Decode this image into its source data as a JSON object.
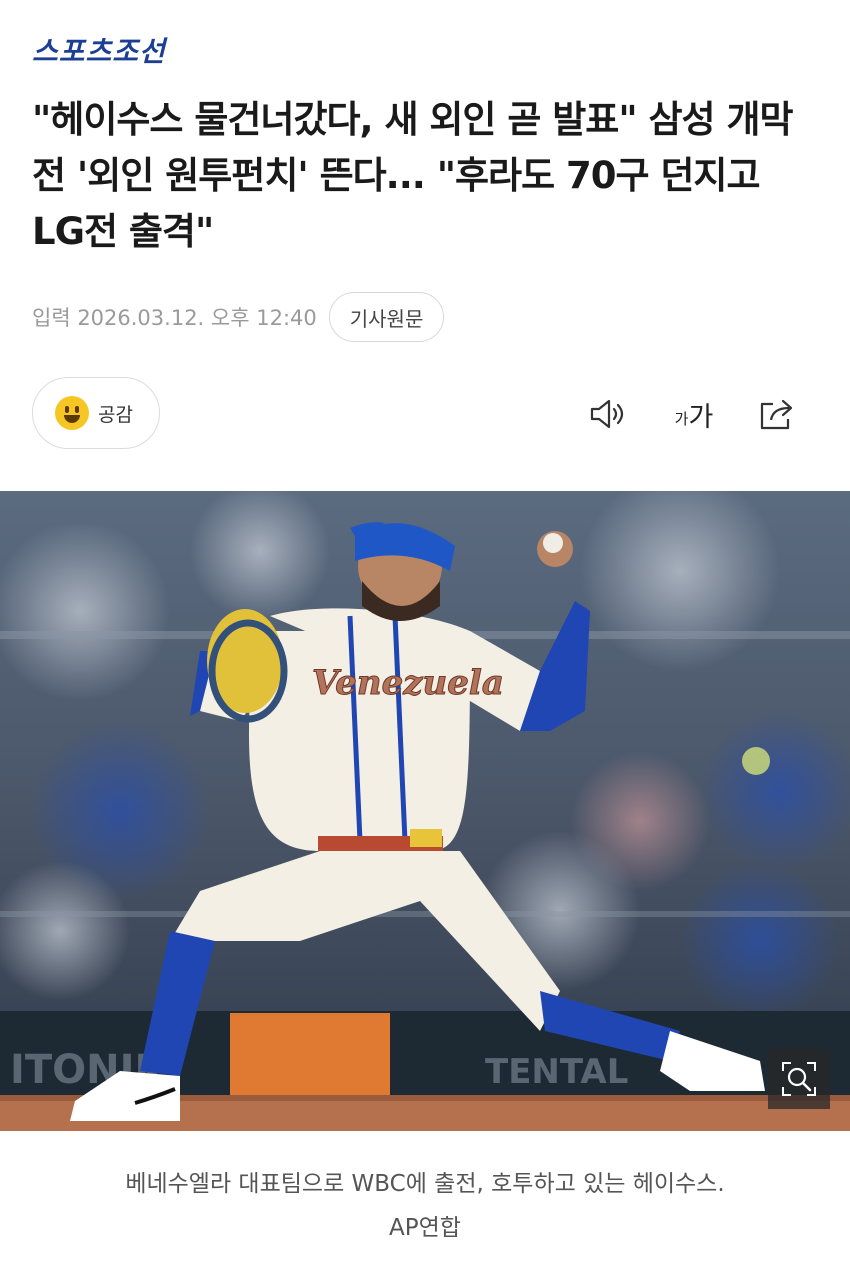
{
  "header": {
    "logo_text": "스포츠조선"
  },
  "article": {
    "headline": "\"헤이수스 물건너갔다, 새 외인 곧 발표\" 삼성 개막전 '외인 원투펀치' 뜬다... \"후라도 70구 던지고 LG전 출격\"",
    "date_label": "입력 2026.03.12. 오후 12:40",
    "original_button": "기사원문"
  },
  "actions": {
    "reaction_label": "공감",
    "font_small": "가",
    "font_large": "가"
  },
  "photo": {
    "jersey_text": "Venezuela",
    "board_left": "ITONIK",
    "board_right": "TENTAL"
  },
  "caption": {
    "line1": "베네수엘라 대표팀으로 WBC에 출전, 호투하고 있는 헤이수스.",
    "line2": "AP연합"
  },
  "colors": {
    "logo": "#1c3f94",
    "jersey_blue": "#2046b3",
    "cap_blue": "#1f57c7",
    "jersey_cream": "#f4efe4"
  },
  "icons": [
    "speaker-icon",
    "font-size-icon",
    "share-icon",
    "zoom-icon",
    "smile-emoji-icon"
  ]
}
